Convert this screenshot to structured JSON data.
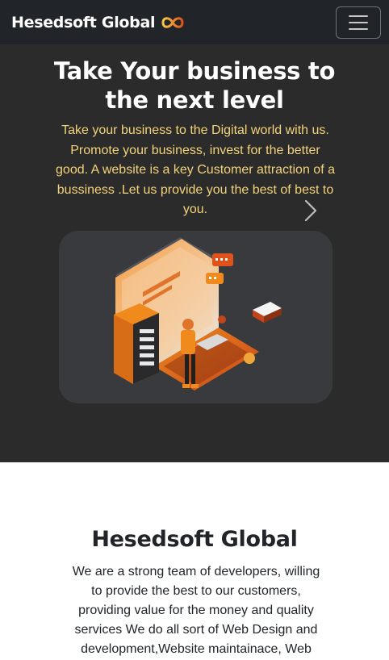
{
  "navbar": {
    "brand": "Hesedsoft Global",
    "logo_icon": "infinity-logo-icon",
    "menu_icon": "hamburger-menu-icon"
  },
  "hero": {
    "title": "Take Your business to the next level",
    "text": "Take your business to the Digital world with us. Promote your business, invest for the better good. A website is a key Customer attraction of a bussiness .Let us provide you the best of best to you.",
    "next_icon": "chevron-right-icon",
    "illustration": "developer-laptop-server-illustration"
  },
  "about": {
    "title": "Hesedsoft Global",
    "text": "We are a strong team of developers, willing to provide the best to our customers, providing value for the money and quality services We do all sort of Web Design and development,Website maintainace, Web"
  },
  "colors": {
    "navbar_bg": "#212529",
    "hero_bg": "#2b2b2b",
    "hero_text": "#f3d37a",
    "accent_orange": "#f08a1c"
  }
}
